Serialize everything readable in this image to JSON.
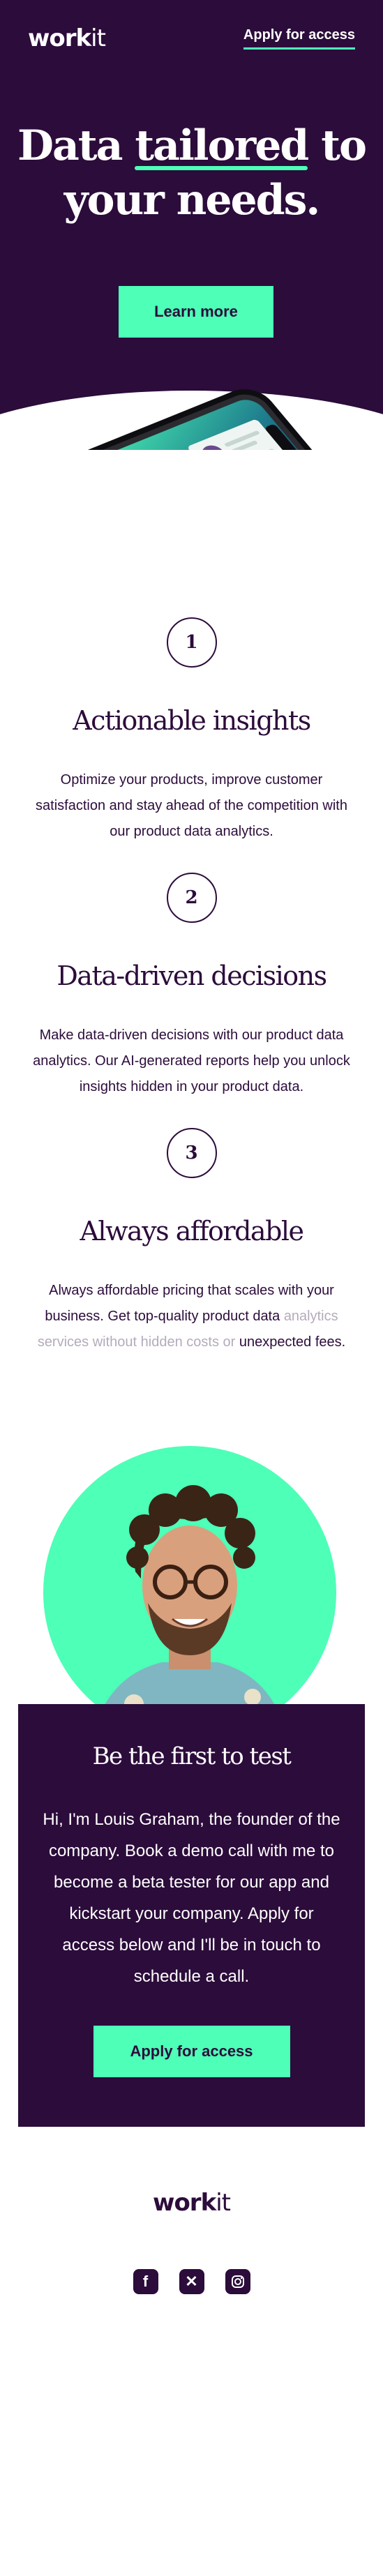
{
  "header": {
    "logo_bold": "work",
    "logo_regular": "it",
    "nav_cta": "Apply for access"
  },
  "hero": {
    "title_part1": "Data ",
    "title_highlight": "tailored",
    "title_part2": " to",
    "title_line2": "your needs.",
    "cta": "Learn more"
  },
  "features": [
    {
      "number": "1",
      "title": "Actionable insights",
      "text": "Optimize your products, improve customer satisfaction and stay ahead of the competition with our product data analytics."
    },
    {
      "number": "2",
      "title": "Data-driven decisions",
      "text": "Make data-driven decisions with our product data analytics. Our AI-generated reports help you unlock insights hidden in your product data."
    },
    {
      "number": "3",
      "title": "Always affordable",
      "text": "Always affordable pricing that scales with your business. Get top-quality product data",
      "text_faded": "analytics services without hidden costs or",
      "text_end": "unexpected fees."
    }
  ],
  "founder": {
    "title": "Be the first to test",
    "text": "Hi, I'm Louis Graham, the founder of the company. Book a demo call with me to become a beta tester for our app and kickstart your company. Apply for access below and I'll be in touch to schedule a call.",
    "cta": "Apply for access"
  },
  "footer": {
    "logo_bold": "work",
    "logo_regular": "it",
    "socials": [
      "facebook-icon",
      "x-icon",
      "instagram-icon"
    ]
  },
  "colors": {
    "brand_dark": "#2c0c3b",
    "accent": "#4dffb7",
    "background": "#ffffff"
  }
}
